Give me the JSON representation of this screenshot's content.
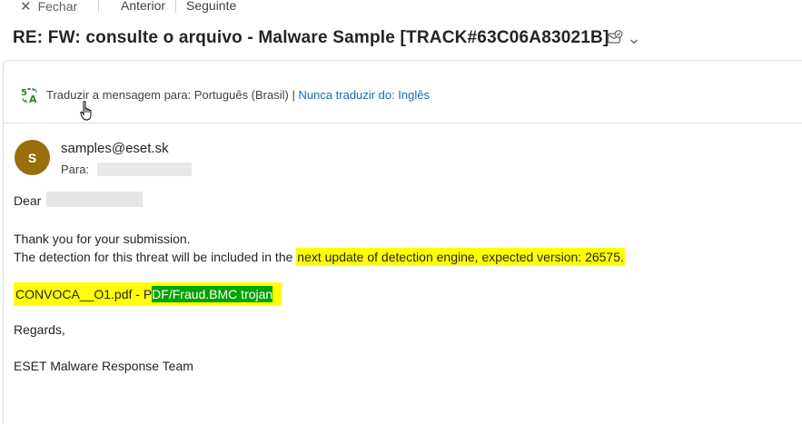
{
  "toolbar": {
    "close_label": "Fechar",
    "prev_label": "Anterior",
    "next_label": "Seguinte"
  },
  "subject": "RE: FW: consulte o arquivo - Malware Sample [TRACK#63C06A83021B]",
  "translate": {
    "prompt": "Traduzir a mensagem para: Português (Brasil)",
    "separator": " | ",
    "never_label": "Nunca traduzir do: Inglês"
  },
  "message": {
    "avatar_initial": "S",
    "sender": "samples@eset.sk",
    "to_label": "Para:",
    "greeting": "Dear",
    "line1": "Thank you for your submission.",
    "line2_prefix": "The detection for this threat will be included in the ",
    "line2_highlight": "next update of detection engine, expected version: 26575.",
    "file_prefix": "CONVOCA__O1.pdf - P",
    "file_detection": "DF/Fraud.BMC trojan",
    "regards": "Regards,",
    "signature": "ESET Malware Response Team"
  },
  "colors": {
    "avatar": "#986f0b",
    "highlight_yellow": "#ffff00",
    "highlight_green": "#00a300",
    "link_blue": "#0f6cbd"
  }
}
